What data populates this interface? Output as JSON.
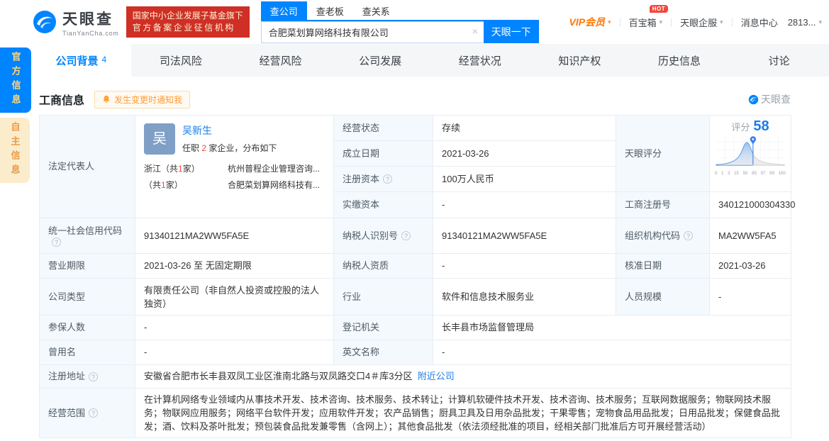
{
  "header": {
    "logo": {
      "title": "天眼查",
      "subtitle": "TianYanCha.com"
    },
    "badge": {
      "line1": "国家中小企业发展子基金旗下",
      "line2": "官方备案企业征信机构"
    },
    "search": {
      "tabs": [
        "查公司",
        "查老板",
        "查关系"
      ],
      "value": "合肥菜划算网络科技有限公司",
      "button": "天眼一下"
    },
    "nav": {
      "vip": "VIP会员",
      "hot": "HOT",
      "treasure": "百宝箱",
      "services": "天眼企服",
      "messages": "消息中心",
      "count": "2813..."
    }
  },
  "sidebar": {
    "official": "官方信息",
    "self": "自主信息"
  },
  "tabs": [
    {
      "label": "公司背景",
      "count": "4"
    },
    {
      "label": "司法风险"
    },
    {
      "label": "经营风险"
    },
    {
      "label": "公司发展"
    },
    {
      "label": "经营状况"
    },
    {
      "label": "知识产权"
    },
    {
      "label": "历史信息"
    },
    {
      "label": "讨论"
    }
  ],
  "section": {
    "title": "工商信息",
    "notify": "发生变更时通知我",
    "watermark": "天眼查"
  },
  "score": {
    "title": "评分",
    "value": "58",
    "axis": [
      "0",
      "1",
      "3",
      "15",
      "50",
      "85",
      "97",
      "99",
      "100"
    ]
  },
  "legal_rep": {
    "label": "法定代表人",
    "avatar": "吴",
    "name": "吴新生",
    "tenure_prefix": "任职",
    "tenure_count": "2",
    "tenure_suffix": "家企业，分布如下",
    "row1_region_prefix": "浙江（共",
    "row1_count": "1",
    "row1_region_suffix": "家）",
    "row1_company": "杭州普程企业管理咨询...",
    "row2_region_prefix": "（共",
    "row2_count": "1",
    "row2_region_suffix": "家）",
    "row2_company": "合肥菜划算网络科技有..."
  },
  "fields": {
    "status_label": "经营状态",
    "status": "存续",
    "est_date_label": "成立日期",
    "est_date": "2021-03-26",
    "reg_capital_label": "注册资本",
    "reg_capital": "100万人民币",
    "paid_capital_label": "实缴资本",
    "paid_capital": "-",
    "score_label": "天眼评分",
    "reg_no_label": "工商注册号",
    "reg_no": "340121000304330",
    "uscc_label": "统一社会信用代码",
    "uscc": "91340121MA2WW5FA5E",
    "taxpayer_label": "纳税人识别号",
    "taxpayer": "91340121MA2WW5FA5E",
    "org_code_label": "组织机构代码",
    "org_code": "MA2WW5FA5",
    "term_label": "营业期限",
    "term": "2021-03-26 至 无固定期限",
    "tax_qual_label": "纳税人资质",
    "tax_qual": "-",
    "approve_label": "核准日期",
    "approve": "2021-03-26",
    "type_label": "公司类型",
    "type": "有限责任公司（非自然人投资或控股的法人独资）",
    "industry_label": "行业",
    "industry": "软件和信息技术服务业",
    "staff_label": "人员规模",
    "staff": "-",
    "insured_label": "参保人数",
    "insured": "-",
    "registry_label": "登记机关",
    "registry": "长丰县市场监督管理局",
    "former_label": "曾用名",
    "former": "-",
    "english_label": "英文名称",
    "english": "-",
    "addr_label": "注册地址",
    "addr": "安徽省合肥市长丰县双凤工业区淮南北路与双凤路交口4＃库3分区",
    "addr_link": "附近公司",
    "scope_label": "经营范围",
    "scope": "在计算机网络专业领域内从事技术开发、技术咨询、技术服务、技术转让；计算机软硬件技术开发、技术咨询、技术服务；互联网数据服务；物联网技术服务；物联网应用服务；网络平台软件开发；应用软件开发；农产品销售；厨具卫具及日用杂品批发；干果零售；宠物食品用品批发；日用品批发；保健食品批发；酒、饮料及茶叶批发；预包装食品批发兼零售（含网上）；其他食品批发（依法须经批准的项目，经相关部门批准后方可开展经营活动）"
  },
  "colors": {
    "accent": "#0084ff",
    "vip_orange": "#ff7700",
    "badge_red": "#cf2f25",
    "count_red": "#f0483e",
    "link_blue": "#1a7de8",
    "label_bg": "#f3f9fd"
  }
}
